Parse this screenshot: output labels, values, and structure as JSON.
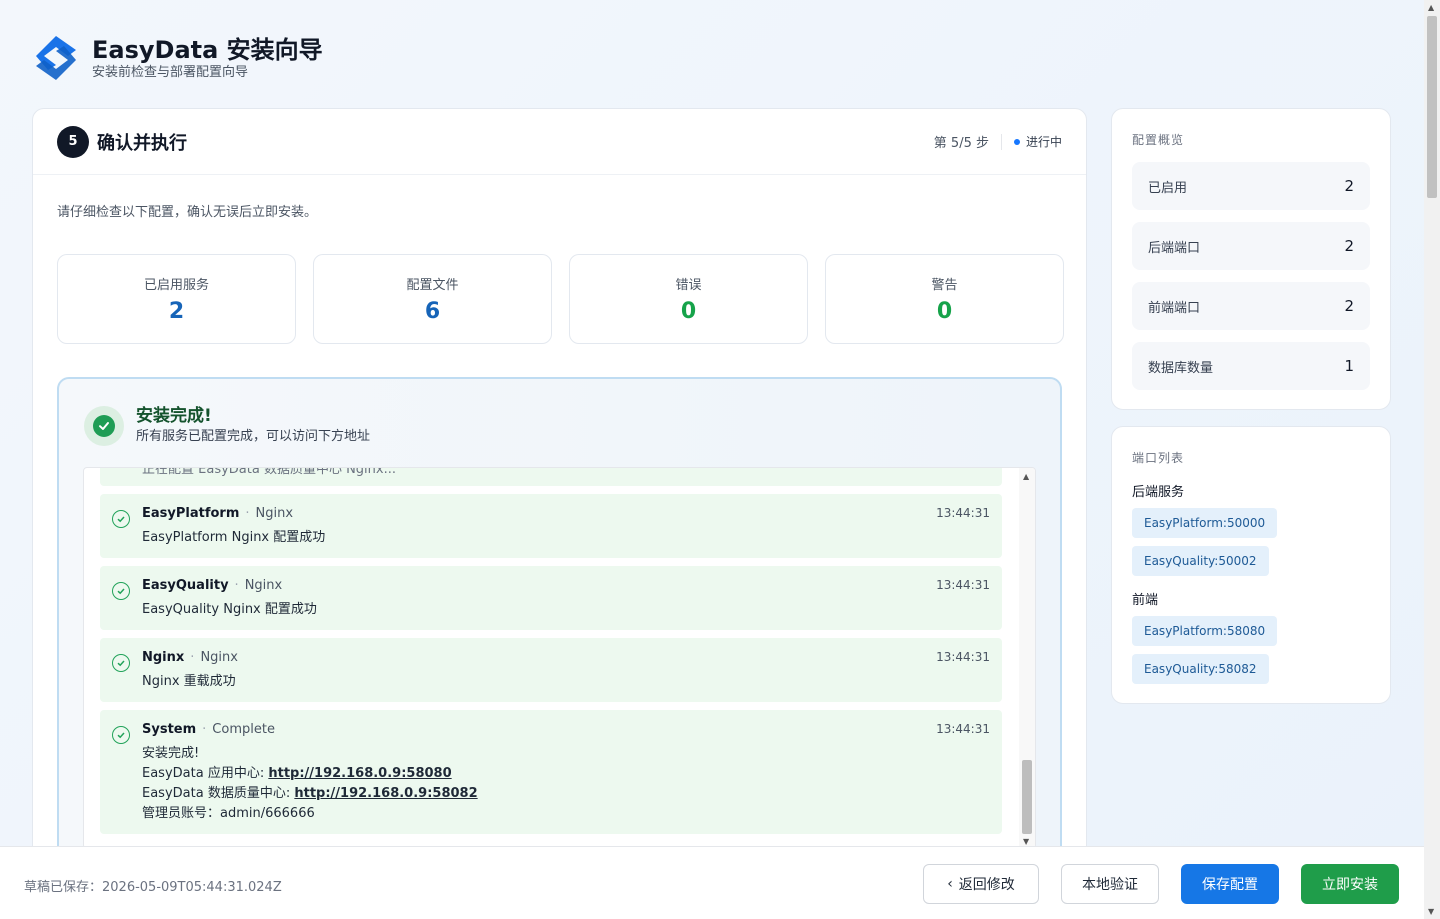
{
  "app": {
    "title": "EasyData 安装向导",
    "subtitle": "安装前检查与部署配置向导"
  },
  "step": {
    "number": "5",
    "title": "确认并执行",
    "progress": "第 5/5 步",
    "status": "进行中",
    "intro": "请仔细检查以下配置，确认无误后立即安装。"
  },
  "stats": [
    {
      "label": "已启用服务",
      "value": "2",
      "color": "#1664b8"
    },
    {
      "label": "配置文件",
      "value": "6",
      "color": "#1664b8"
    },
    {
      "label": "错误",
      "value": "0",
      "color": "#16a34a"
    },
    {
      "label": "警告",
      "value": "0",
      "color": "#16a34a"
    }
  ],
  "success": {
    "title": "安装完成!",
    "subtitle": "所有服务已配置完成，可以访问下方地址"
  },
  "logs": {
    "partial": "正在配置 EasyData 数据质量中心 Nginx...",
    "items": [
      {
        "name": "EasyPlatform",
        "kind": "Nginx",
        "time": "13:44:31",
        "lines": [
          "EasyPlatform Nginx 配置成功"
        ]
      },
      {
        "name": "EasyQuality",
        "kind": "Nginx",
        "time": "13:44:31",
        "lines": [
          "EasyQuality Nginx 配置成功"
        ]
      },
      {
        "name": "Nginx",
        "kind": "Nginx",
        "time": "13:44:31",
        "lines": [
          "Nginx 重载成功"
        ]
      },
      {
        "name": "System",
        "kind": "Complete",
        "time": "13:44:31",
        "line1": "安装完成!",
        "line2_prefix": "EasyData 应用中心: ",
        "line2_link": "http://192.168.0.9:58080",
        "line3_prefix": "EasyData 数据质量中心: ",
        "line3_link": "http://192.168.0.9:58082",
        "line4": "管理员账号：admin/666666"
      }
    ]
  },
  "overview": {
    "title": "配置概览",
    "rows": [
      {
        "label": "已启用",
        "value": "2"
      },
      {
        "label": "后端端口",
        "value": "2"
      },
      {
        "label": "前端端口",
        "value": "2"
      },
      {
        "label": "数据库数量",
        "value": "1"
      }
    ]
  },
  "ports": {
    "title": "端口列表",
    "backend_label": "后端服务",
    "backend": [
      "EasyPlatform:50000",
      "EasyQuality:50002"
    ],
    "frontend_label": "前端",
    "frontend": [
      "EasyPlatform:58080",
      "EasyQuality:58082"
    ]
  },
  "footer": {
    "draft": "草稿已保存：2026-05-09T05:44:31.024Z",
    "back": "返回修改",
    "validate": "本地验证",
    "save": "保存配置",
    "install": "立即安装"
  },
  "colors": {
    "accent": "#1677e6",
    "success": "#1f9d4a",
    "primary_dark": "#111827"
  }
}
